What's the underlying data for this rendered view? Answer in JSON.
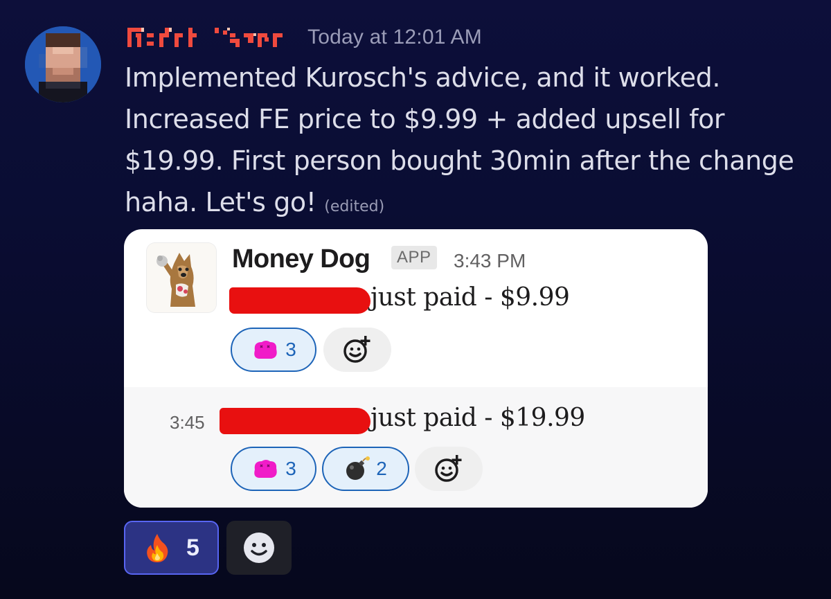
{
  "discord_message": {
    "author": "Alexandr Ivanov",
    "timestamp": "Today at 12:01 AM",
    "text_lines": [
      "Implemented Kurosch's advice, and it worked.",
      "Increased FE price to $9.99 + added upsell for",
      "$19.99. First person bought 30min after the change",
      "haha. Let's go!"
    ],
    "edited_label": "(edited)",
    "reactions": [
      {
        "icon": "fire-icon",
        "emoji": "🔥",
        "count": "5"
      }
    ],
    "add_reaction_icon": "smiley-add-icon"
  },
  "slack_embed": {
    "bot_name": "Money Dog",
    "badge": "APP",
    "time": "3:43 PM",
    "messages": [
      {
        "time": "",
        "text": "just paid - $9.99",
        "reactions": [
          {
            "icon": "pink-blob-icon",
            "count": "3"
          }
        ]
      },
      {
        "time": "3:45",
        "text": "just paid - $19.99",
        "reactions": [
          {
            "icon": "pink-blob-icon",
            "count": "3"
          },
          {
            "icon": "bomb-icon",
            "count": "2"
          }
        ]
      }
    ]
  },
  "colors": {
    "background": "#0b0d35",
    "discord_accent": "#5865f2",
    "redaction": "#e81010",
    "slack_reaction_border": "#1d64b8"
  }
}
